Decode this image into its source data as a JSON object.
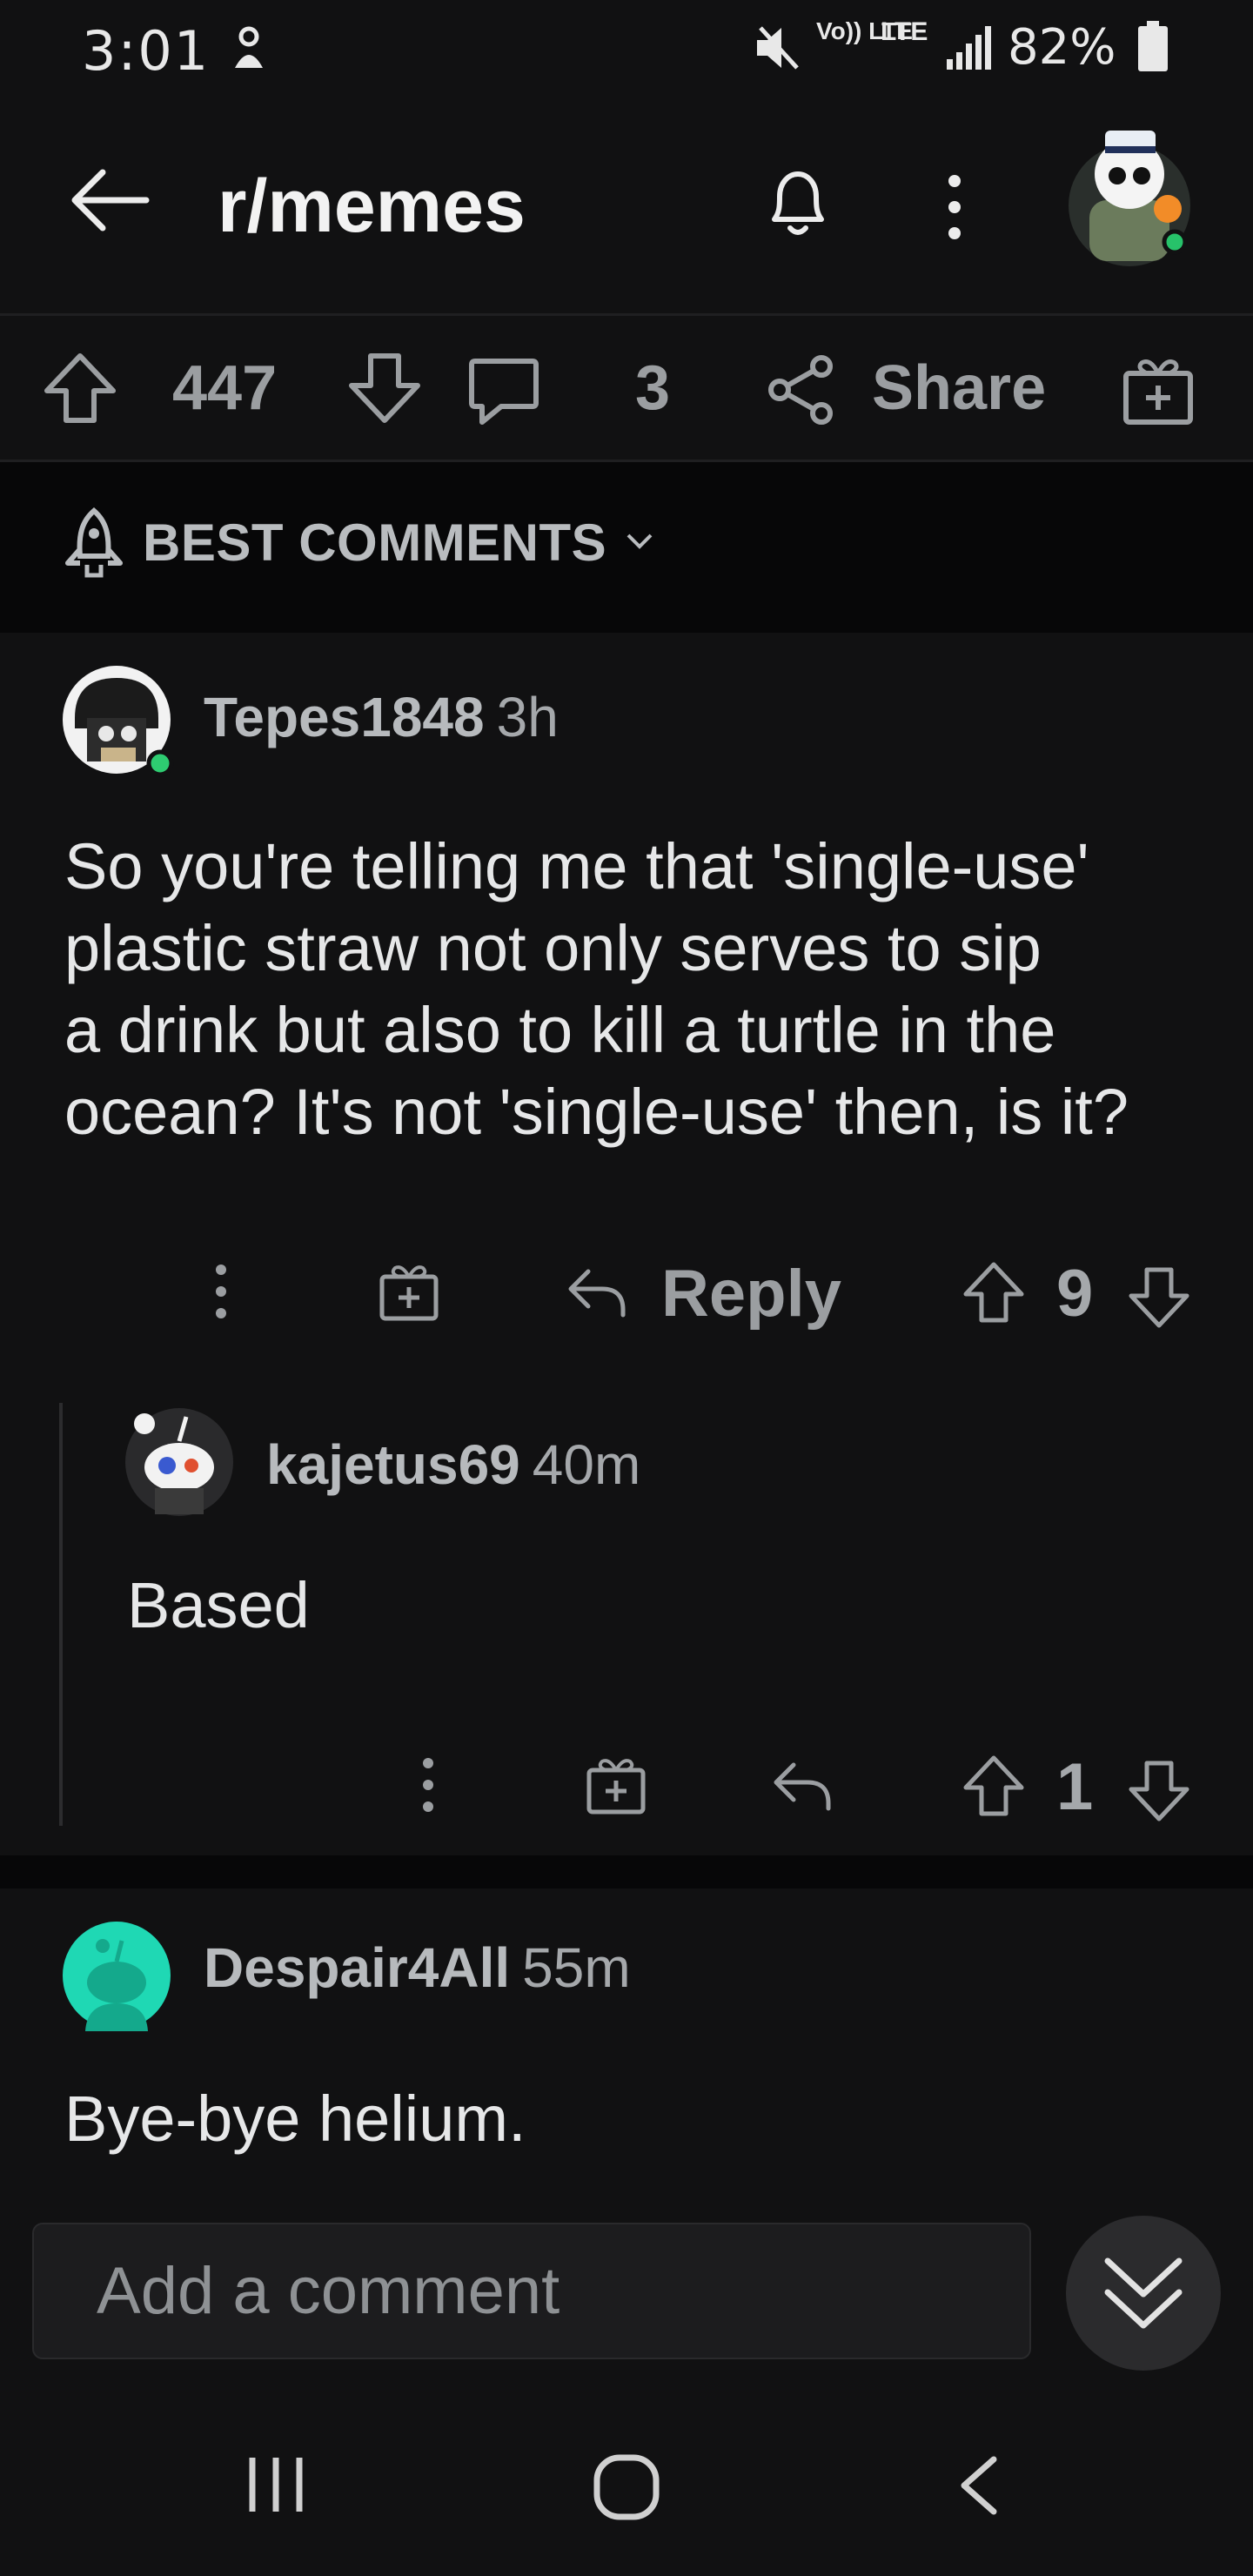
{
  "status_bar": {
    "time": "3:01",
    "battery": "82%",
    "network_top": "Vo)) LTE",
    "network_lte": "LTE"
  },
  "header": {
    "title": "r/memes",
    "icons": [
      "back-arrow-icon",
      "bell-icon",
      "more-vertical-icon",
      "avatar"
    ]
  },
  "post_bar": {
    "score": "447",
    "comment_count": "3",
    "share_label": "Share"
  },
  "sort": {
    "label": "BEST COMMENTS"
  },
  "comments": [
    {
      "username": "Tepes1848",
      "age": "3h",
      "body_lines": [
        "So you're telling me that 'single-use'",
        "plastic straw not only serves to sip",
        "a drink but also to kill a turtle in the",
        "ocean? It's not 'single-use' then, is it?"
      ],
      "reply_label": "Reply",
      "score": "9",
      "online": true
    },
    {
      "username": "kajetus69",
      "age": "40m",
      "body_lines": [
        "Based"
      ],
      "score": "1"
    },
    {
      "username": "Despair4All",
      "age": "55m",
      "body_lines": [
        "Bye-bye helium."
      ]
    }
  ],
  "composer": {
    "placeholder": "Add a comment"
  },
  "colors": {
    "background": "#111112",
    "online_dot": "#2ecc71",
    "avatar_teal": "#1fd8b4"
  }
}
